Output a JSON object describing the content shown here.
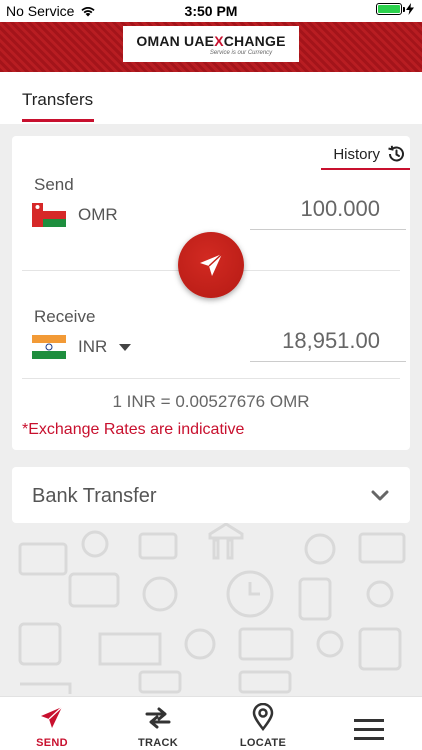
{
  "status_bar": {
    "carrier": "No Service",
    "time": "3:50 PM",
    "icons": [
      "wifi-icon",
      "battery-icon",
      "charging-bolt-icon"
    ]
  },
  "brand": {
    "logo_part1": "OMAN UAE",
    "logo_x": "X",
    "logo_part2": "CHANGE",
    "tagline": "Service is our Currency"
  },
  "tabs": {
    "active_label": "Transfers"
  },
  "converter": {
    "history_label": "History",
    "send_label": "Send",
    "send_currency": "OMR",
    "send_amount": "100.000",
    "receive_label": "Receive",
    "receive_currency": "INR",
    "receive_amount": "18,951.00",
    "rate_text": "1 INR = 0.00527676 OMR",
    "disclaimer": "*Exchange Rates are indicative"
  },
  "transfer_type": {
    "selected": "Bank Transfer"
  },
  "bottom_nav": {
    "send": "SEND",
    "track": "TRACK",
    "locate": "LOCATE"
  },
  "colors": {
    "brand_red": "#c8102e",
    "send_button": "#c7221a",
    "accent_text": "#c8102e"
  }
}
